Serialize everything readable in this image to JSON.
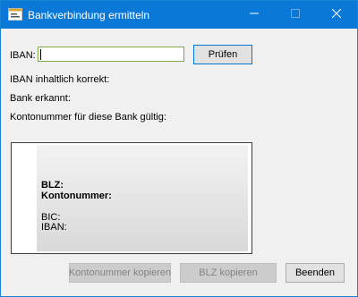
{
  "window": {
    "title": "Bankverbindung ermitteln",
    "icons": {
      "app": "app-window-icon",
      "minimize": "minimize-icon",
      "maximize": "maximize-icon",
      "close": "close-icon"
    }
  },
  "form": {
    "iban_label": "IBAN:",
    "iban_value": "",
    "check_button": "Prüfen",
    "status": {
      "iban_correct": "IBAN inhaltlich korrekt:",
      "bank_recognized": "Bank erkannt:",
      "account_valid": "Kontonummer für diese Bank gültig:"
    }
  },
  "result": {
    "blz_label": "BLZ:",
    "account_label": "Kontonummer:",
    "bic_label": "BIC:",
    "iban_label": "IBAN:"
  },
  "footer": {
    "copy_account_button": "Kontonummer kopieren",
    "copy_blz_button": "BLZ kopieren",
    "exit_button": "Beenden"
  },
  "colors": {
    "titlebar": "#0a78d7",
    "input_border_focus": "#7aa948",
    "default_button_border": "#0078d7"
  }
}
